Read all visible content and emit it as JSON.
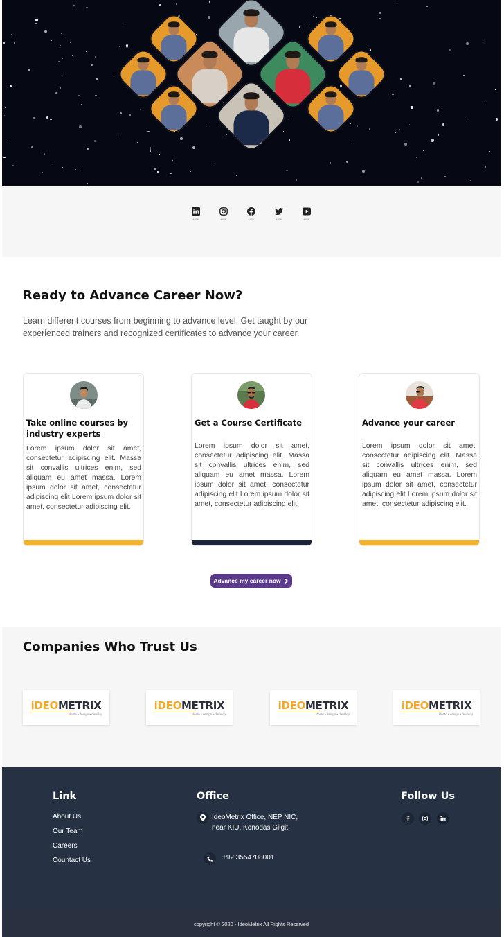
{
  "social": {
    "items": [
      {
        "name": "linkedin",
        "count": "440K"
      },
      {
        "name": "instagram",
        "count": "440K"
      },
      {
        "name": "facebook",
        "count": "440K"
      },
      {
        "name": "twitter",
        "count": "440K"
      },
      {
        "name": "youtube",
        "count": "440K"
      }
    ]
  },
  "career": {
    "title": "Ready to Advance Career Now?",
    "description": "Learn different courses from beginning to advance level. Get taught by our experienced trainers and recognized certificates to advance your career.",
    "cards": [
      {
        "title": "Take online courses by industry experts",
        "body": "Lorem ipsum dolor sit amet, consectetur adipiscing elit. Massa sit convallis ultrices enim, sed aliquam eu amet massa. Lorem ipsum dolor sit amet, consectetur adipiscing elit Lorem ipsum dolor sit amet, consectetur adipiscing elit.",
        "bar_color": "#f2b22f"
      },
      {
        "title": "Get a Course Certificate",
        "body": "Lorem ipsum dolor sit amet, consectetur adipiscing elit. Massa sit convallis ultrices enim, sed aliquam eu amet massa. Lorem ipsum dolor sit amet, consectetur adipiscing elit Lorem ipsum dolor sit amet, consectetur adipiscing elit.",
        "bar_color": "#1c2638"
      },
      {
        "title": "Advance your career",
        "body": "Lorem ipsum dolor sit amet, consectetur adipiscing elit. Massa sit convallis ultrices enim, sed aliquam eu amet massa. Lorem ipsum dolor sit amet, consectetur adipiscing elit Lorem ipsum dolor sit amet, consectetur adipiscing elit.",
        "bar_color": "#f2b22f"
      }
    ],
    "cta_label": "Advance my career now",
    "cta_color": "#5b3a8c"
  },
  "companies": {
    "title": "Companies Who Trust Us",
    "logo": {
      "part1": "iDEO",
      "part2": "METRIX",
      "tagline": "ideate • design • develop"
    },
    "count": 4
  },
  "footer": {
    "link_heading": "Link",
    "links": [
      "About Us",
      "Our Team",
      "Careers",
      "Countact Us"
    ],
    "office_heading": "Office",
    "address_line1": "IdeoMetrix Office, NEP NIC,",
    "address_line2": "near KIU, Konodas Gilgit.",
    "phone": "+92 3554708001",
    "follow_heading": "Follow Us",
    "follow_icons": [
      "facebook-icon",
      "instagram-icon",
      "linkedin-icon"
    ],
    "copyright": "copyright © 2020 - IdeoMetrix All Rights Reserved"
  },
  "colors": {
    "accent_yellow": "#f2b22f",
    "navy": "#1c2638",
    "footer_bg": "#263244",
    "cta_purple": "#5b3a8c"
  }
}
